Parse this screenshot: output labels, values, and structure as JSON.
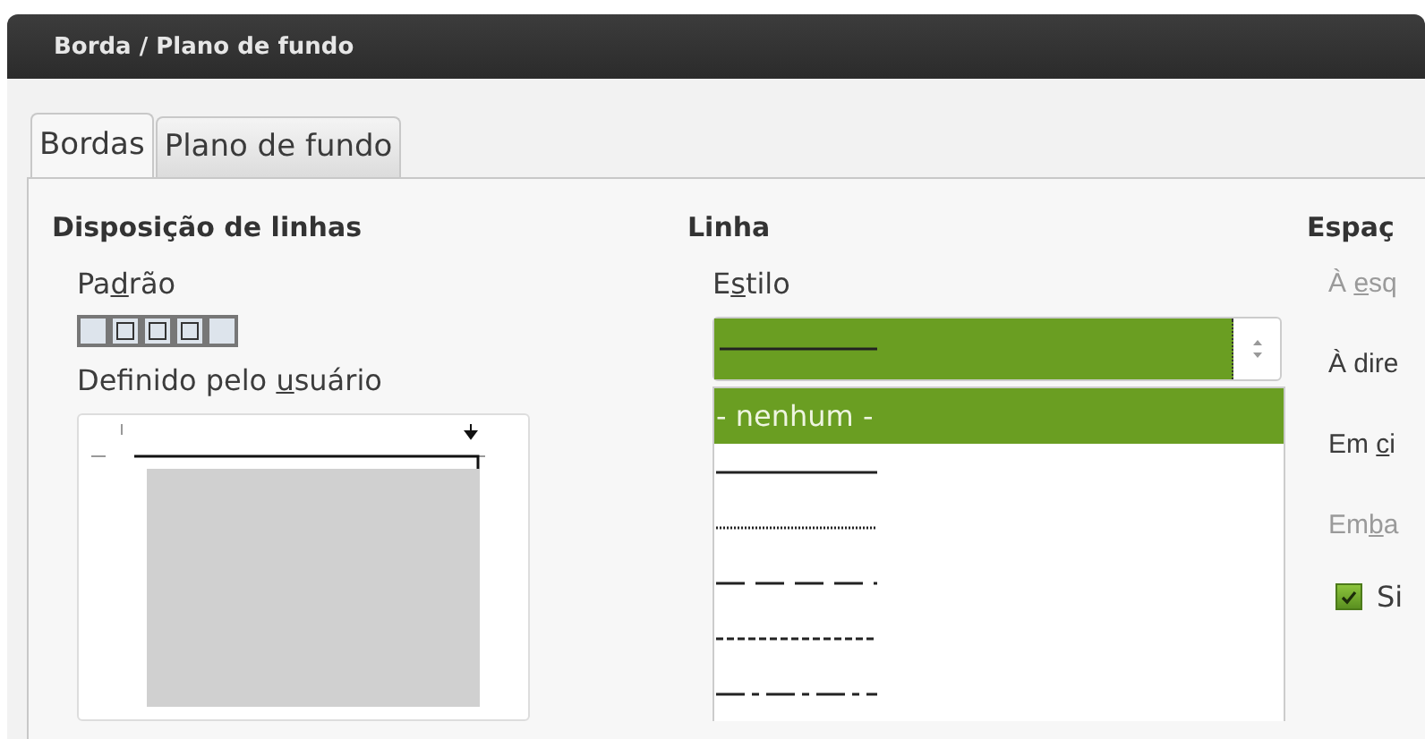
{
  "window": {
    "title": "Borda / Plano de fundo"
  },
  "tabs": [
    {
      "label": "Bordas",
      "selected": true
    },
    {
      "label": "Plano de fundo",
      "selected": false
    }
  ],
  "line_arrangement": {
    "heading": "Disposição de linhas",
    "default_label": {
      "before": "Pa",
      "key": "d",
      "after": "rão"
    },
    "presets": [
      {
        "kind": "none"
      },
      {
        "kind": "box"
      },
      {
        "kind": "box"
      },
      {
        "kind": "box"
      },
      {
        "kind": "none"
      }
    ],
    "user_defined_label": {
      "before": "Definido pelo ",
      "key": "u",
      "after": "suário"
    }
  },
  "line": {
    "heading": "Linha",
    "style_label": {
      "before": "E",
      "key": "s",
      "after": "tilo"
    },
    "style_options": [
      {
        "kind": "none",
        "label": "- nenhum -",
        "selected": true
      },
      {
        "kind": "solid",
        "selected": false
      },
      {
        "kind": "dotted",
        "selected": false
      },
      {
        "kind": "dashed",
        "selected": false
      },
      {
        "kind": "fine-dashed",
        "selected": false
      },
      {
        "kind": "dash-dot",
        "selected": false
      }
    ]
  },
  "spacing": {
    "heading": "Espaç",
    "fields": [
      {
        "label": {
          "before": "À ",
          "key": "e",
          "after": "sq"
        },
        "disabled": true
      },
      {
        "label": {
          "before": "À dire"
        },
        "disabled": false
      },
      {
        "label": {
          "before": "Em ",
          "key": "c",
          "after": "i"
        },
        "disabled": false
      },
      {
        "label": {
          "before": "Em",
          "key": "b",
          "after": "a"
        },
        "disabled": true
      }
    ],
    "sync": {
      "label": "Si",
      "checked": true
    }
  }
}
